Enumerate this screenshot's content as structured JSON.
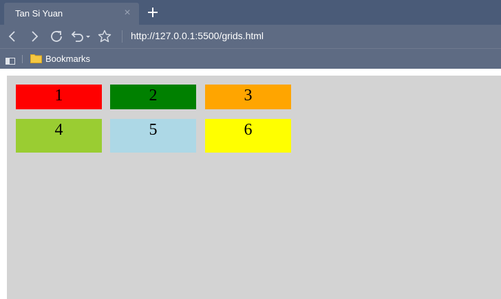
{
  "browser": {
    "tab": {
      "title": "Tan Si Yuan",
      "close": "×"
    },
    "address": {
      "url": "http://127.0.0.1:5500/grids.html"
    },
    "bookmarks": {
      "label": "Bookmarks"
    }
  },
  "icons": {
    "back": "back-icon",
    "forward": "forward-icon",
    "reload": "reload-icon",
    "undo": "undo-icon",
    "star": "star-icon",
    "new_tab": "plus-icon",
    "folder": "folder-icon",
    "sidebar": "sidebar-icon"
  },
  "colors": {
    "tabbar": "#4a5b78",
    "toolbar": "#5e6b83",
    "page_bg": "#d3d3d3"
  },
  "grid": {
    "items": [
      {
        "label": "1",
        "color": "#ff0000"
      },
      {
        "label": "2",
        "color": "#008000"
      },
      {
        "label": "3",
        "color": "#ffa500"
      },
      {
        "label": "4",
        "color": "#9acd32"
      },
      {
        "label": "5",
        "color": "#add8e6"
      },
      {
        "label": "6",
        "color": "#ffff00"
      }
    ]
  }
}
